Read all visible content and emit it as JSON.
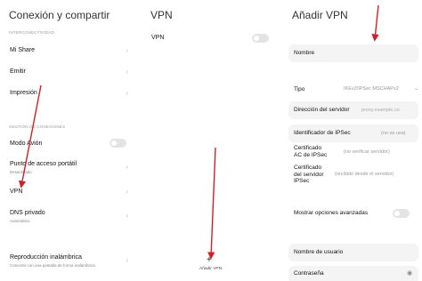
{
  "panel1": {
    "title": "Conexión y compartir",
    "section_conn": "INTERCONECTIVIDAD",
    "section_mgmt": "GESTIÓN DE CONEXIONES",
    "items": {
      "mishare": "Mi Share",
      "emitir": "Emitir",
      "impresion": "Impresión",
      "modo_avion": "Modo Avión",
      "hotspot": "Punto de acceso portátil",
      "hotspot_sub": "Desactivado",
      "vpn": "VPN",
      "dns": "DNS privado",
      "dns_sub": "Automático",
      "wireless": "Reproducción inalámbrica",
      "wireless_sub": "Conectar con una pantalla de forma inalámbrica"
    }
  },
  "panel2": {
    "title": "VPN",
    "vpn_label": "VPN",
    "add_label": "Añadir VPN"
  },
  "panel3": {
    "title": "Añadir VPN",
    "name_label": "Nombre",
    "type_label": "Tipo",
    "type_value": "IKEv2/IPSec MSCHAPv2",
    "server_label": "Dirección del servidor",
    "server_placeholder": "proxy.example.co",
    "ipsec_id_label": "Identificador de IPSec",
    "ipsec_id_value": "(no se usa)",
    "ca_cert_label": "Certificado\nAC de IPSec",
    "ca_cert_value": "(no verificar servidor)",
    "server_cert_label": "Certificado\ndel servidor\nIPSec",
    "server_cert_value": "(recibido desde el servidor)",
    "advanced_label": "Mostrar opciones avanzadas",
    "username_label": "Nombre de usuario",
    "password_label": "Contraseña"
  },
  "colors": {
    "arrow": "#d0202a",
    "toggle_off": "#e4e4e4",
    "field_bg": "#f4f4f4"
  }
}
